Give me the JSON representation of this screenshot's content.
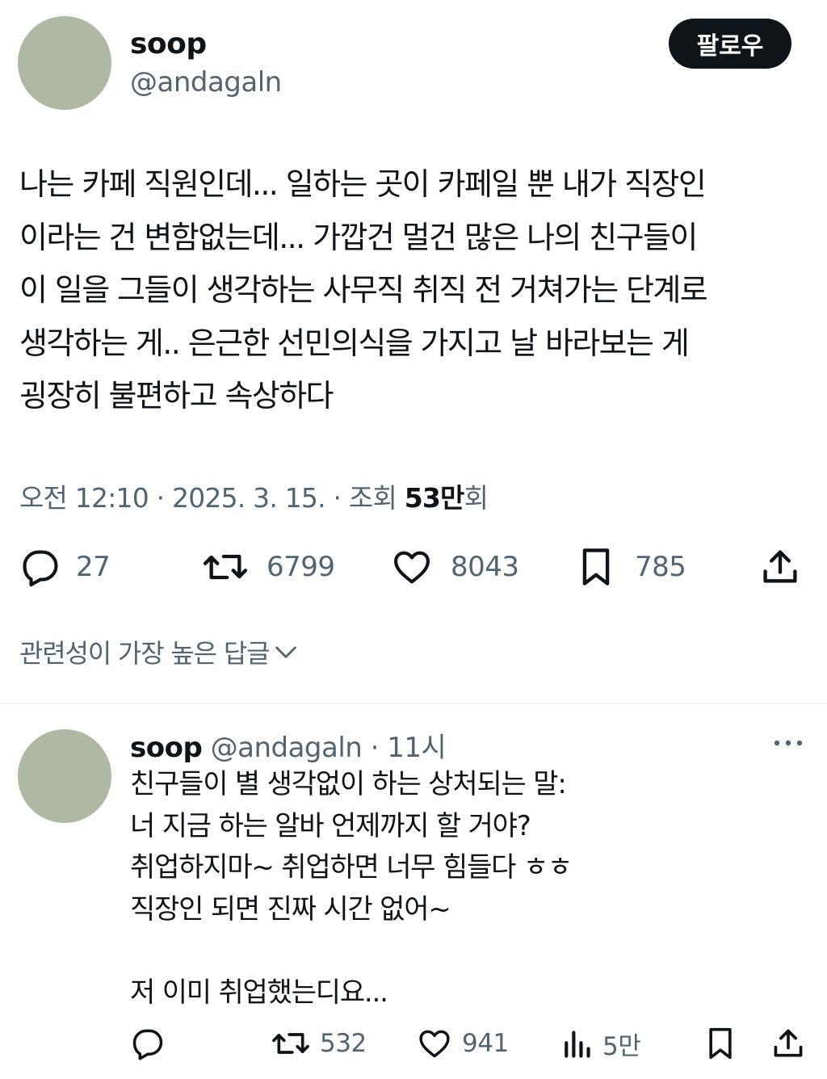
{
  "main_tweet": {
    "display_name": "soop",
    "handle": "@andagaln",
    "follow_label": "팔로우",
    "lines": [
      "나는 카페 직원인데... 일하는 곳이 카페일 뿐 내가 직장인",
      "이라는 건 변함없는데... 가깝건 멀건 많은 나의 친구들이",
      "이 일을 그들이 생각하는 사무직 취직 전 거쳐가는 단계로",
      "생각하는 게.. 은근한 선민의식을 가지고 날 바라보는 게",
      "굉장히 불편하고 속상하다"
    ],
    "meta": {
      "time": "오전 12:10",
      "sep": " · ",
      "date": "2025. 3. 15.",
      "views_prefix": "조회 ",
      "views_value": "53만",
      "views_suffix": "회"
    },
    "actions": {
      "replies": "27",
      "retweets": "6799",
      "likes": "8043",
      "bookmarks": "785"
    }
  },
  "sort_label": "관련성이 가장 높은 답글",
  "reply": {
    "display_name": "soop",
    "handle": "@andagaln",
    "time": "11시",
    "lines": [
      "친구들이 별 생각없이 하는 상처되는 말:",
      "너 지금 하는 알바 언제까지 할 거야?",
      "취업하지마~ 취업하면 너무 힘들다 ㅎㅎ",
      "직장인 되면 진짜 시간 없어~",
      "",
      "저 이미 취업했는디요..."
    ],
    "actions": {
      "retweets": "532",
      "likes": "941",
      "views": "5만"
    }
  },
  "colors": {
    "text": "#0f1419",
    "secondary": "#536471",
    "avatar": "#aeb8a3",
    "divider": "#eff3f4"
  },
  "icons": [
    "reply-icon",
    "retweet-icon",
    "like-icon",
    "bookmark-icon",
    "share-icon",
    "chevron-down-icon",
    "more-icon",
    "views-icon"
  ]
}
